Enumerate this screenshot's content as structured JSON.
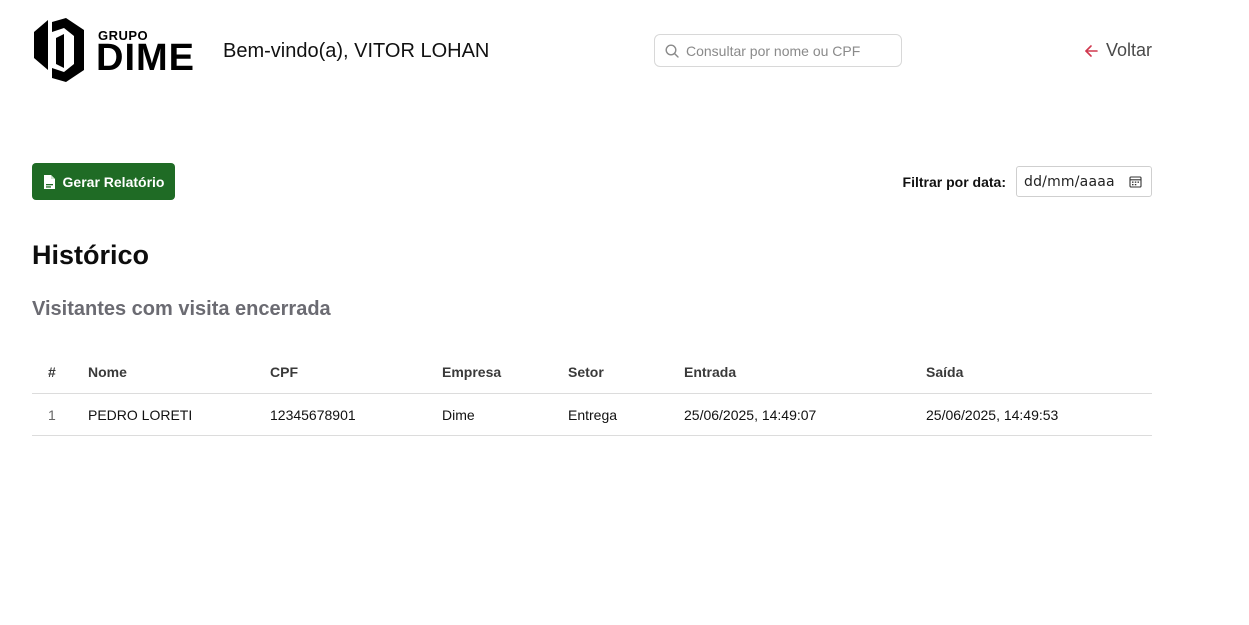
{
  "header": {
    "logo": {
      "small_text": "GRUPO",
      "big_text": "DIME"
    },
    "welcome_text": "Bem-vindo(a), VITOR LOHAN",
    "search": {
      "placeholder": "Consultar por nome ou CPF",
      "value": "",
      "icon": "search-icon"
    },
    "back": {
      "label": "Voltar",
      "icon": "arrow-left-icon",
      "icon_color": "#d0384f"
    }
  },
  "toolbar": {
    "report_button": {
      "label": "Gerar Relatório",
      "icon": "document-icon",
      "bg_color": "#1f6b25"
    },
    "date_filter": {
      "label": "Filtrar por data:",
      "placeholder": "dd/mm/aaaa",
      "icon": "calendar-icon"
    }
  },
  "main": {
    "title": "Histórico",
    "subtitle": "Visitantes com visita encerrada",
    "table": {
      "columns": [
        "#",
        "Nome",
        "CPF",
        "Empresa",
        "Setor",
        "Entrada",
        "Saída"
      ],
      "rows": [
        {
          "index": "1",
          "nome": "PEDRO LORETI",
          "cpf": "12345678901",
          "empresa": "Dime",
          "setor": "Entrega",
          "entrada": "25/06/2025, 14:49:07",
          "saida": "25/06/2025, 14:49:53"
        }
      ]
    }
  }
}
